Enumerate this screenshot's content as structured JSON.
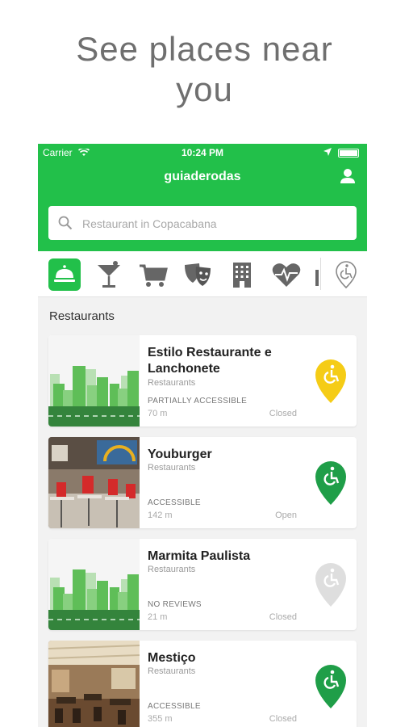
{
  "promo": {
    "line1": "See places near",
    "line2": "you"
  },
  "status_bar": {
    "carrier": "Carrier",
    "time": "10:24 PM"
  },
  "header": {
    "app_name": "guiaderodas"
  },
  "search": {
    "placeholder": "Restaurant in Copacabana"
  },
  "categories": [
    {
      "icon": "restaurant-icon",
      "active": true
    },
    {
      "icon": "cocktail-icon",
      "active": false
    },
    {
      "icon": "shopping-cart-icon",
      "active": false
    },
    {
      "icon": "theater-masks-icon",
      "active": false
    },
    {
      "icon": "hotel-building-icon",
      "active": false
    },
    {
      "icon": "health-heart-icon",
      "active": false
    },
    {
      "icon": "wheelchair-pin-icon",
      "active": false
    }
  ],
  "section": {
    "title": "Restaurants"
  },
  "places": [
    {
      "name": "Estilo Restaurante e Lanchonete",
      "category": "Restaurants",
      "accessibility": "PARTIALLY ACCESSIBLE",
      "distance": "70 m",
      "status": "Closed",
      "pin_color": "#f5cc16",
      "thumb": "city-illustration"
    },
    {
      "name": "Youburger",
      "category": "Restaurants",
      "accessibility": "ACCESSIBLE",
      "distance": "142 m",
      "status": "Open",
      "pin_color": "#1f9e48",
      "thumb": "restaurant-photo"
    },
    {
      "name": "Marmita Paulista",
      "category": "Restaurants",
      "accessibility": "NO REVIEWS",
      "distance": "21 m",
      "status": "Closed",
      "pin_color": "#dedede",
      "thumb": "city-illustration"
    },
    {
      "name": "Mestiço",
      "category": "Restaurants",
      "accessibility": "ACCESSIBLE",
      "distance": "355 m",
      "status": "Closed",
      "pin_color": "#1f9e48",
      "thumb": "restaurant-photo"
    }
  ],
  "colors": {
    "brand_green": "#22c04a"
  }
}
